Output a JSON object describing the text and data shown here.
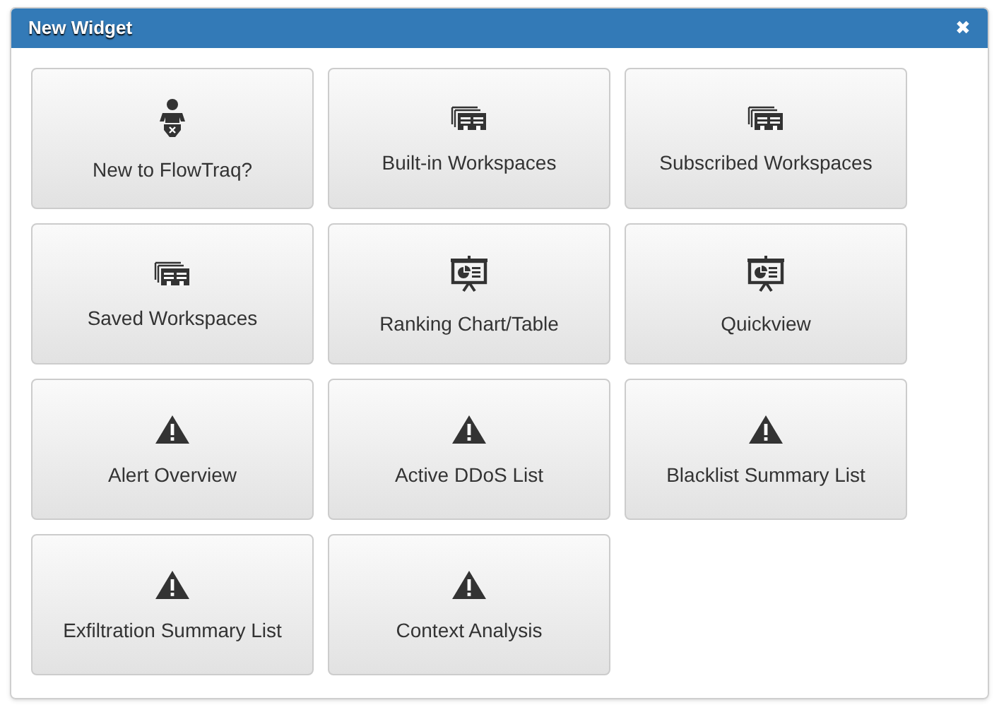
{
  "dialog": {
    "title": "New Widget",
    "close": "✖"
  },
  "tiles": [
    {
      "label": "New to FlowTraq?",
      "kind": "baby"
    },
    {
      "label": "Built-in Workspaces",
      "kind": "workspaces"
    },
    {
      "label": "Subscribed Workspaces",
      "kind": "workspaces"
    },
    {
      "label": "Saved Workspaces",
      "kind": "workspaces"
    },
    {
      "label": "Ranking Chart/Table",
      "kind": "presentation"
    },
    {
      "label": "Quickview",
      "kind": "presentation"
    },
    {
      "label": "Alert Overview",
      "kind": "warning"
    },
    {
      "label": "Active DDoS List",
      "kind": "warning"
    },
    {
      "label": "Blacklist Summary List",
      "kind": "warning"
    },
    {
      "label": "Exfiltration Summary List",
      "kind": "warning"
    },
    {
      "label": "Context Analysis",
      "kind": "warning"
    }
  ]
}
